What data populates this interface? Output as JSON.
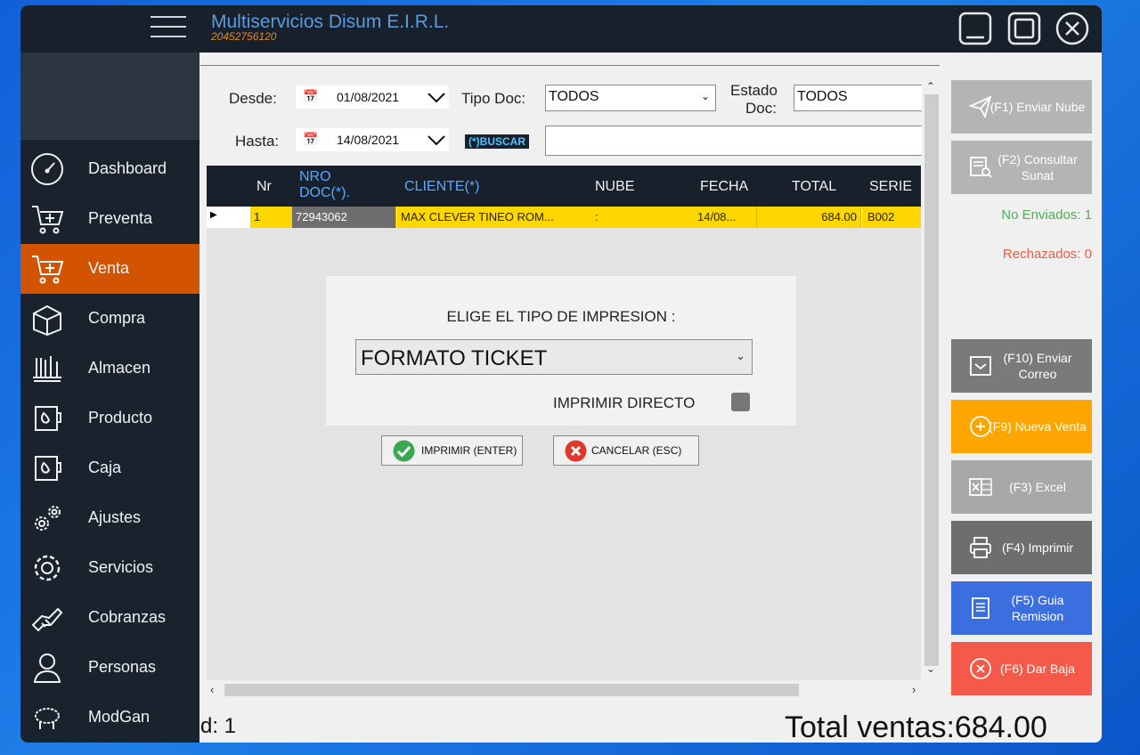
{
  "app": {
    "title": "Multiservicios Disum E.I.R.L.",
    "ruc": "20452756120"
  },
  "sidebar": {
    "items": [
      {
        "label": "Dashboard",
        "icon": "gauge-icon"
      },
      {
        "label": "Preventa",
        "icon": "cart-icon"
      },
      {
        "label": "Venta",
        "icon": "cart-icon",
        "active": true
      },
      {
        "label": "Compra",
        "icon": "box-icon"
      },
      {
        "label": "Almacen",
        "icon": "shelf-icon"
      },
      {
        "label": "Producto",
        "icon": "product-icon"
      },
      {
        "label": "Caja",
        "icon": "product-icon"
      },
      {
        "label": "Ajustes",
        "icon": "gears-icon"
      },
      {
        "label": "Servicios",
        "icon": "gear-icon"
      },
      {
        "label": "Cobranzas",
        "icon": "handshake-icon"
      },
      {
        "label": "Personas",
        "icon": "person-icon"
      },
      {
        "label": "ModGan",
        "icon": "sheep-icon"
      }
    ]
  },
  "filters": {
    "desde_label": "Desde:",
    "desde_value": "01/08/2021",
    "hasta_label": "Hasta:",
    "hasta_value": "14/08/2021",
    "tipo_doc_label": "Tipo Doc:",
    "tipo_doc_value": "TODOS",
    "estado_label": "Estado",
    "estado_label2": "Doc:",
    "estado_value": "TODOS",
    "buscar_label": "(*)BUSCAR",
    "buscar_value": ""
  },
  "grid": {
    "columns": [
      "Nr",
      "NRO DOC(*).",
      "CLIENTE(*)",
      "NUBE",
      "FECHA",
      "TOTAL",
      "SERIE"
    ],
    "rows": [
      {
        "nr": "1",
        "nro_doc": "72943062",
        "cliente": "MAX CLEVER TINEO ROM...",
        "nube": ":",
        "fecha": "14/08...",
        "total": "684.00",
        "serie": "B002"
      }
    ]
  },
  "dialog": {
    "title": "ELIGE EL TIPO DE IMPRESION :",
    "format_value": "FORMATO TICKET",
    "direct_label": "IMPRIMIR DIRECTO",
    "print_button": "IMPRIMIR (ENTER)",
    "cancel_button": "CANCELAR (ESC)"
  },
  "status": {
    "no_enviados": "No Enviados: 1",
    "rechazados": "Rechazados: 0"
  },
  "actions": [
    {
      "label": "(F1) Enviar Nube",
      "color": "#b4b4b4",
      "icon": "send-icon"
    },
    {
      "label": "(F2) Consultar Sunat",
      "color": "#b4b4b4",
      "icon": "doc-search-icon"
    },
    {
      "label": "(F10) Enviar Correo",
      "color": "#7a7a7a",
      "icon": "mail-icon"
    },
    {
      "label": "(F9) Nueva Venta",
      "color": "#ffa500",
      "icon": "plus-icon"
    },
    {
      "label": "(F3) Excel",
      "color": "#a8a8a8",
      "icon": "excel-icon"
    },
    {
      "label": "(F4) Imprimir",
      "color": "#6e6e6e",
      "icon": "printer-icon"
    },
    {
      "label": "(F5) Guia Remision",
      "color": "#3b6fe0",
      "icon": "guide-icon"
    },
    {
      "label": "(F6) Dar Baja",
      "color": "#f4594a",
      "icon": "close-circle-icon"
    }
  ],
  "footer": {
    "count_text": "d: 1",
    "total_text": "Total ventas:684.00"
  },
  "colors": {
    "sidebar_bg": "#1a232d",
    "active": "#d35400",
    "highlight_row": "#ffd700",
    "title_blue": "#5a9be0",
    "ruc_orange": "#e08a2a"
  }
}
